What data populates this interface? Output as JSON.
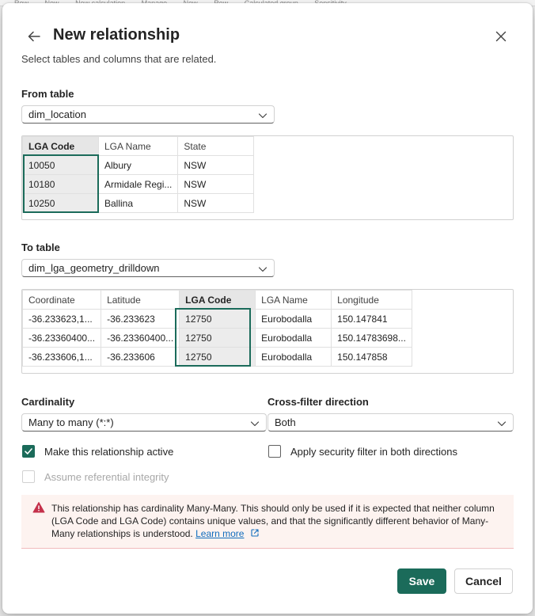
{
  "dialog": {
    "title": "New relationship",
    "subtitle": "Select tables and columns that are related."
  },
  "background_menu": [
    "Row",
    "New",
    "New calculation",
    "Manage",
    "New",
    "Row",
    "Calculated group",
    "Sensitivity"
  ],
  "from_table": {
    "label": "From table",
    "selected": "dim_location",
    "columns": [
      "LGA Code",
      "LGA Name",
      "State"
    ],
    "selected_column": "LGA Code",
    "rows": [
      [
        "10050",
        "Albury",
        "NSW"
      ],
      [
        "10180",
        "Armidale Regi...",
        "NSW"
      ],
      [
        "10250",
        "Ballina",
        "NSW"
      ]
    ]
  },
  "to_table": {
    "label": "To table",
    "selected": "dim_lga_geometry_drilldown",
    "columns": [
      "Coordinate",
      "Latitude",
      "LGA Code",
      "LGA Name",
      "Longitude"
    ],
    "selected_column": "LGA Code",
    "rows": [
      [
        "-36.233623,1...",
        "-36.233623",
        "12750",
        "Eurobodalla",
        "150.147841"
      ],
      [
        "-36.23360400...",
        "-36.23360400...",
        "12750",
        "Eurobodalla",
        "150.14783698..."
      ],
      [
        "-36.233606,1...",
        "-36.233606",
        "12750",
        "Eurobodalla",
        "150.147858"
      ]
    ]
  },
  "cardinality": {
    "label": "Cardinality",
    "selected": "Many to many (*:*)"
  },
  "cross_filter": {
    "label": "Cross-filter direction",
    "selected": "Both"
  },
  "options": {
    "make_active": {
      "label": "Make this relationship active",
      "checked": true
    },
    "security_filter": {
      "label": "Apply security filter in both directions",
      "checked": false
    },
    "referential_integrity": {
      "label": "Assume referential integrity",
      "checked": false,
      "disabled": true
    }
  },
  "warning": {
    "text": "This relationship has cardinality Many-Many. This should only be used if it is expected that neither column (LGA Code and LGA Code) contains unique values, and that the significantly different behavior of Many-Many relationships is understood.",
    "link_text": "Learn more",
    "icon": "warning-icon"
  },
  "buttons": {
    "save": "Save",
    "cancel": "Cancel"
  },
  "colors": {
    "accent": "#1b6b5a",
    "warning_bg": "#fdf3f0",
    "warning_icon": "#c4314b",
    "link": "#0f6cbd"
  }
}
